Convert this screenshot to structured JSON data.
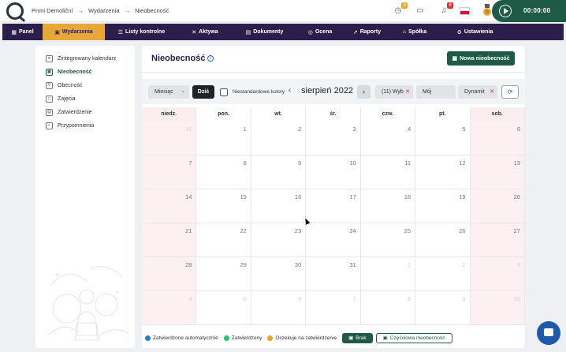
{
  "breadcrumb": [
    "Prvni Demoliční",
    "Wydarzenia",
    "Nieobecność"
  ],
  "breadcrumb_sep": "→",
  "top_icons": [
    {
      "name": "clock-icon",
      "badge": "3",
      "badge_color": "#e7a83a"
    },
    {
      "name": "chat-icon",
      "badge": ""
    },
    {
      "name": "bell-icon",
      "badge": "8",
      "badge_color": "#d9342b"
    }
  ],
  "timer": {
    "time": "00:00:00"
  },
  "nav": [
    {
      "icon": "▦",
      "label": "Panel"
    },
    {
      "icon": "▣",
      "label": "Wydarzenia",
      "active": true
    },
    {
      "icon": "☰",
      "label": "Listy kontrolne"
    },
    {
      "icon": "✕",
      "label": "Aktywa"
    },
    {
      "icon": "▤",
      "label": "Dokumenty"
    },
    {
      "icon": "◎",
      "label": "Ocena"
    },
    {
      "icon": "↗",
      "label": "Raporty"
    },
    {
      "icon": "⌂",
      "label": "Spółka"
    },
    {
      "icon": "⚙",
      "label": "Ustawienia"
    }
  ],
  "sidebar": {
    "items": [
      {
        "label": "Zintegrowany kalendarz",
        "icon": "layers-icon"
      },
      {
        "label": "Nieobecność",
        "icon": "calendar-icon",
        "active": true
      },
      {
        "label": "Obecność",
        "icon": "person-walk-icon"
      },
      {
        "label": "Zajęcia",
        "icon": "book-icon"
      },
      {
        "label": "Zatwierdzenie",
        "icon": "document-check-icon"
      },
      {
        "label": "Przypomnienia",
        "icon": "palette-icon"
      }
    ]
  },
  "page": {
    "title": "Nieobecność",
    "new_button": "Nowa nieobecność"
  },
  "toolbar": {
    "view": "Miesiąc",
    "today": "Dziś",
    "custom_colors": "Niestandardowe kolory",
    "period": "sierpień 2022",
    "filters": [
      {
        "label": "(11) Wyb",
        "removable": true
      },
      {
        "label": "Mój",
        "removable": false
      },
      {
        "label": "Dynamit",
        "removable": true
      }
    ]
  },
  "calendar": {
    "weekdays": [
      "niedz.",
      "pon.",
      "wt.",
      "śr.",
      "czw.",
      "pt.",
      "sob."
    ],
    "weeks": [
      [
        {
          "d": "31",
          "o": true
        },
        {
          "d": "1"
        },
        {
          "d": "2"
        },
        {
          "d": "3"
        },
        {
          "d": "4"
        },
        {
          "d": "5"
        },
        {
          "d": "6"
        }
      ],
      [
        {
          "d": "7"
        },
        {
          "d": "8"
        },
        {
          "d": "9"
        },
        {
          "d": "10"
        },
        {
          "d": "11"
        },
        {
          "d": "12"
        },
        {
          "d": "13"
        }
      ],
      [
        {
          "d": "14"
        },
        {
          "d": "15"
        },
        {
          "d": "16"
        },
        {
          "d": "17"
        },
        {
          "d": "18"
        },
        {
          "d": "19"
        },
        {
          "d": "20"
        }
      ],
      [
        {
          "d": "21"
        },
        {
          "d": "22"
        },
        {
          "d": "23"
        },
        {
          "d": "24"
        },
        {
          "d": "25"
        },
        {
          "d": "26"
        },
        {
          "d": "27"
        }
      ],
      [
        {
          "d": "28"
        },
        {
          "d": "29"
        },
        {
          "d": "30"
        },
        {
          "d": "31"
        },
        {
          "d": "1",
          "o": true
        },
        {
          "d": "2",
          "o": true
        },
        {
          "d": "3",
          "o": true
        }
      ],
      [
        {
          "d": "4",
          "o": true
        },
        {
          "d": "5",
          "o": true
        },
        {
          "d": "6",
          "o": true
        },
        {
          "d": "7",
          "o": true
        },
        {
          "d": "8",
          "o": true
        },
        {
          "d": "9",
          "o": true
        },
        {
          "d": "10",
          "o": true
        }
      ]
    ]
  },
  "legend": {
    "items": [
      {
        "label": "Zatwierdzone automatycznie",
        "color": "#2a7bc4"
      },
      {
        "label": "Zatwierdzony",
        "color": "#2fbf71"
      },
      {
        "label": "Oczekuje na zatwierdzenie",
        "color": "#f0a02a"
      }
    ],
    "brak": "Brak",
    "partial": "Częściowa nieobecność"
  }
}
